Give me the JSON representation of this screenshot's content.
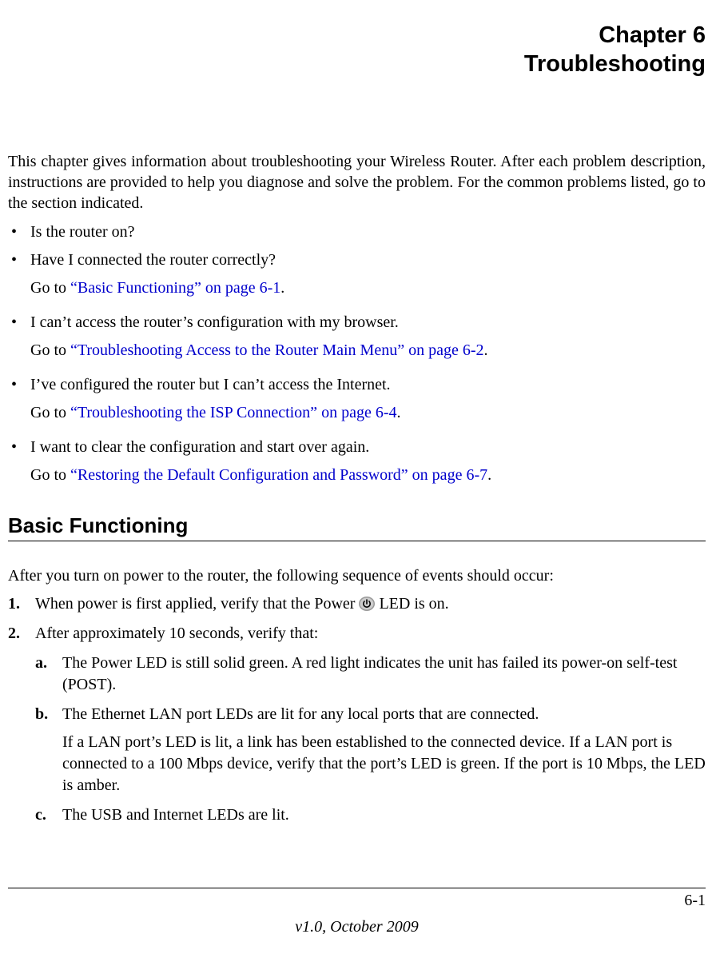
{
  "chapter": {
    "number_line": "Chapter 6",
    "title": "Troubleshooting"
  },
  "intro": "This chapter gives information about troubleshooting your Wireless Router. After each problem description, instructions are provided to help you diagnose and solve the problem. For the common problems listed, go to the section indicated.",
  "bullets": [
    {
      "text": "Is the router on?",
      "goto_prefix": "",
      "link": "",
      "goto_suffix": ""
    },
    {
      "text": "Have I connected the router correctly?",
      "goto_prefix": "Go to ",
      "link": "“Basic Functioning” on page 6-1",
      "goto_suffix": "."
    },
    {
      "text": "I can’t access the router’s configuration with my browser.",
      "goto_prefix": "Go to ",
      "link": "“Troubleshooting Access to the Router Main Menu” on page 6-2",
      "goto_suffix": "."
    },
    {
      "text": "I’ve configured the router but I can’t access the Internet.",
      "goto_prefix": "Go to ",
      "link": "“Troubleshooting the ISP Connection” on page 6-4",
      "goto_suffix": "."
    },
    {
      "text": "I want to clear the configuration and start over again.",
      "goto_prefix": "Go to ",
      "link": "“Restoring the Default Configuration and Password” on page 6-7",
      "goto_suffix": "."
    }
  ],
  "section": {
    "heading": "Basic Functioning",
    "intro": "After you turn on power to the router, the following sequence of events should occur:",
    "items": [
      {
        "marker": "1.",
        "text_before_icon": "When power is first applied, verify that the Power ",
        "text_after_icon": " LED is on.",
        "subitems": []
      },
      {
        "marker": "2.",
        "text_before_icon": "After approximately 10 seconds, verify that:",
        "text_after_icon": "",
        "subitems": [
          {
            "marker": "a.",
            "text": "The Power LED is still solid green. A red light indicates the unit has failed its power-on self-test (POST).",
            "extra": ""
          },
          {
            "marker": "b.",
            "text": "The Ethernet LAN port LEDs are lit for any local ports that are connected.",
            "extra": "If a LAN port’s LED is lit, a link has been established to the connected device. If a LAN port is connected to a 100 Mbps device, verify that the port’s LED is green. If the port is 10 Mbps, the LED is amber."
          },
          {
            "marker": "c.",
            "text": "The USB and Internet LEDs are lit.",
            "extra": ""
          }
        ]
      }
    ]
  },
  "footer": {
    "page": "6-1",
    "version": "v1.0, October 2009"
  }
}
